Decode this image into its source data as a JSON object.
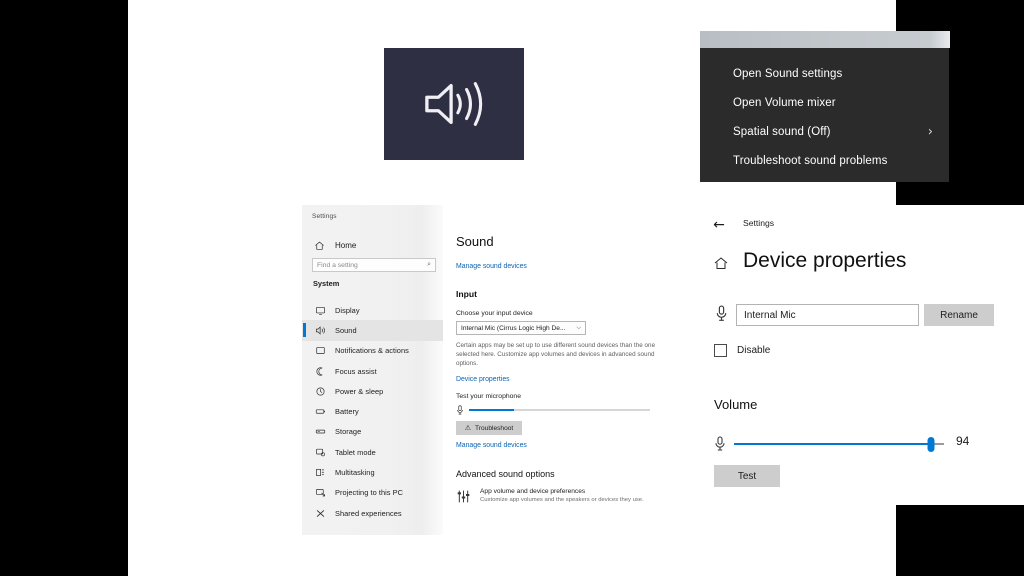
{
  "theme": {
    "accent": "#0078d4",
    "tile_bg": "#2f2f44",
    "menu_bg": "#2b2b2b",
    "link": "#0a64b4"
  },
  "speaker_tile": {
    "icon": "speaker-volume-icon"
  },
  "context_menu": {
    "items": [
      {
        "label": "Open Sound settings",
        "has_submenu": false
      },
      {
        "label": "Open Volume mixer",
        "has_submenu": false
      },
      {
        "label": "Spatial sound (Off)",
        "has_submenu": true,
        "chevron": "›"
      },
      {
        "label": "Troubleshoot sound problems",
        "has_submenu": false
      }
    ]
  },
  "settings": {
    "window_title": "Settings",
    "home": {
      "label": "Home",
      "icon": "home-icon"
    },
    "search": {
      "placeholder": "Find a setting",
      "icon": "search-icon",
      "glyph": "⌕"
    },
    "group_label": "System",
    "nav": [
      {
        "label": "Display",
        "icon": "display-icon",
        "selected": false
      },
      {
        "label": "Sound",
        "icon": "sound-icon",
        "selected": true
      },
      {
        "label": "Notifications & actions",
        "icon": "notifications-icon",
        "selected": false
      },
      {
        "label": "Focus assist",
        "icon": "moon-icon",
        "selected": false
      },
      {
        "label": "Power & sleep",
        "icon": "power-icon",
        "selected": false
      },
      {
        "label": "Battery",
        "icon": "battery-icon",
        "selected": false
      },
      {
        "label": "Storage",
        "icon": "storage-icon",
        "selected": false
      },
      {
        "label": "Tablet mode",
        "icon": "tablet-icon",
        "selected": false
      },
      {
        "label": "Multitasking",
        "icon": "multitasking-icon",
        "selected": false
      },
      {
        "label": "Projecting to this PC",
        "icon": "projecting-icon",
        "selected": false
      },
      {
        "label": "Shared experiences",
        "icon": "shared-experiences-icon",
        "selected": false
      }
    ],
    "pane": {
      "title": "Sound",
      "manage_devices_top": "Manage sound devices",
      "input_heading": "Input",
      "choose_label": "Choose your input device",
      "device_value": "Internal Mic (Cirrus Logic High De...",
      "device_chevron": "⌵",
      "description": "Certain apps may be set up to use different sound devices than the one selected here. Customize app volumes and devices in advanced sound options.",
      "device_properties_link": "Device properties",
      "test_mic_label": "Test your microphone",
      "mic_level_percent": 25,
      "troubleshoot_label": "Troubleshoot",
      "troubleshoot_glyph": "⚠",
      "manage_devices_bottom": "Manage sound devices",
      "advanced_heading": "Advanced sound options",
      "app_volume_title": "App volume and device preferences",
      "app_volume_sub": "Customize app volumes and the speakers or devices they use."
    }
  },
  "device_properties": {
    "back_glyph": "←",
    "breadcrumb": "Settings",
    "title": "Device properties",
    "home_icon": "home-icon",
    "mic_icon": "microphone-icon",
    "name_value": "Internal Mic",
    "rename_label": "Rename",
    "disable_label": "Disable",
    "disable_checked": false,
    "volume_heading": "Volume",
    "volume_value": "94",
    "volume_percent": 94,
    "test_label": "Test"
  }
}
